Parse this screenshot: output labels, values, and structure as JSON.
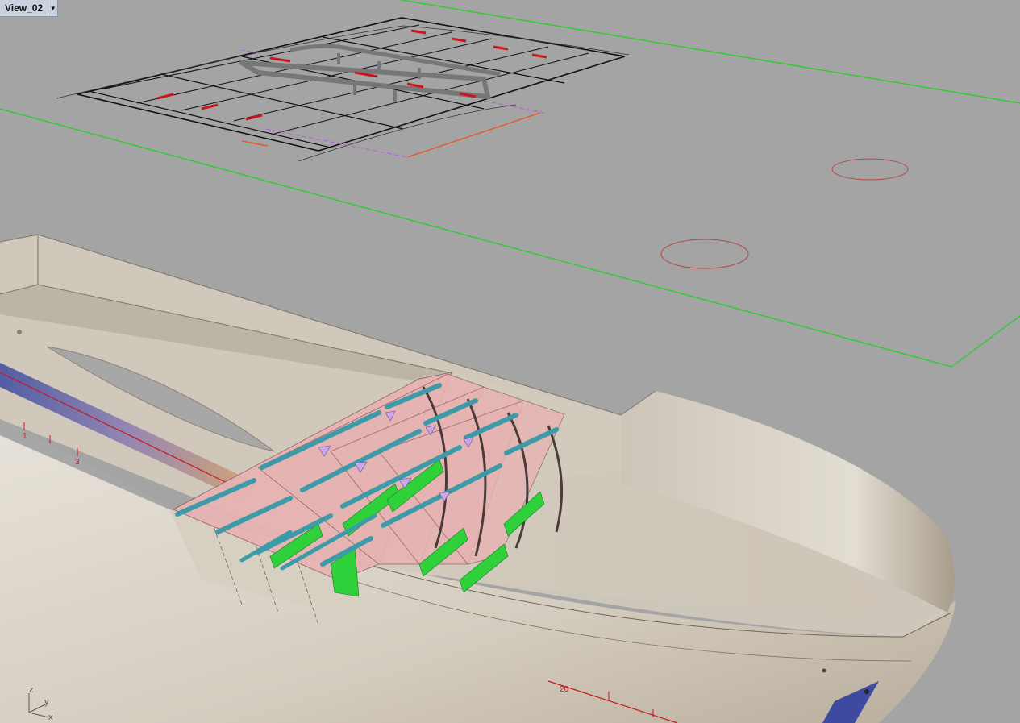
{
  "viewport": {
    "name": "View_02",
    "background": "#a4a4a4"
  },
  "axes": {
    "z": "z",
    "y": "y",
    "x": "x"
  },
  "frame_labels": {
    "a": "1",
    "b": "3",
    "c": "20"
  },
  "colors": {
    "hull": "#dcd6cb",
    "hull_shadow": "#b3aa9a",
    "deck": "#c9c2b6",
    "frame_pink": "#e7b3b3",
    "longitudinal_teal": "#3d9aa8",
    "bracket_green": "#2ed13a",
    "boundary_green": "#2bcc2b",
    "dimension_orange": "#e8582a",
    "layout_line": "#111111"
  }
}
